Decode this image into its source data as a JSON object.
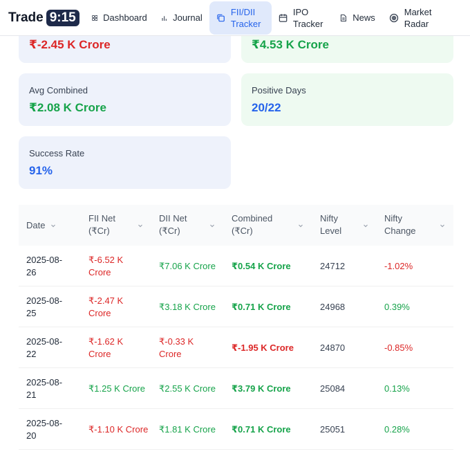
{
  "brand": {
    "name": "Trade",
    "badge": "9:15"
  },
  "nav": {
    "items": [
      {
        "label": "Dashboard",
        "icon": "grid-icon"
      },
      {
        "label": "Journal",
        "icon": "bar-chart-icon"
      },
      {
        "label": "FII/DII Tracker",
        "icon": "copy-icon",
        "active": true
      },
      {
        "label": "IPO Tracker",
        "icon": "calendar-icon"
      },
      {
        "label": "News",
        "icon": "document-icon"
      },
      {
        "label": "Market Radar",
        "icon": "radar-icon"
      }
    ]
  },
  "stats": {
    "top_left_value": "₹-2.45 K Crore",
    "top_right_value": "₹4.53 K Crore",
    "avg_combined": {
      "label": "Avg Combined",
      "value": "₹2.08 K Crore"
    },
    "positive_days": {
      "label": "Positive Days",
      "value": "20/22"
    },
    "success_rate": {
      "label": "Success Rate",
      "value": "91%"
    }
  },
  "table": {
    "headers": [
      "Date",
      "FII Net (₹Cr)",
      "DII Net (₹Cr)",
      "Combined (₹Cr)",
      "Nifty Level",
      "Nifty Change"
    ],
    "rows": [
      {
        "date": "2025-08-26",
        "fii": "₹-6.52 K Crore",
        "dii": "₹7.06 K Crore",
        "combined": "₹0.54 K Crore",
        "nifty": "24712",
        "change": "-1.02%"
      },
      {
        "date": "2025-08-25",
        "fii": "₹-2.47 K Crore",
        "dii": "₹3.18 K Crore",
        "combined": "₹0.71 K Crore",
        "nifty": "24968",
        "change": "0.39%"
      },
      {
        "date": "2025-08-22",
        "fii": "₹-1.62 K Crore",
        "dii": "₹-0.33 K Crore",
        "combined": "₹-1.95 K Crore",
        "nifty": "24870",
        "change": "-0.85%"
      },
      {
        "date": "2025-08-21",
        "fii": "₹1.25 K Crore",
        "dii": "₹2.55 K Crore",
        "combined": "₹3.79 K Crore",
        "nifty": "25084",
        "change": "0.13%"
      },
      {
        "date": "2025-08-20",
        "fii": "₹-1.10 K Crore",
        "dii": "₹1.81 K Crore",
        "combined": "₹0.71 K Crore",
        "nifty": "25051",
        "change": "0.28%"
      }
    ]
  },
  "colors": {
    "positive": "#16a34a",
    "negative": "#dc2626",
    "accent": "#2563eb"
  }
}
